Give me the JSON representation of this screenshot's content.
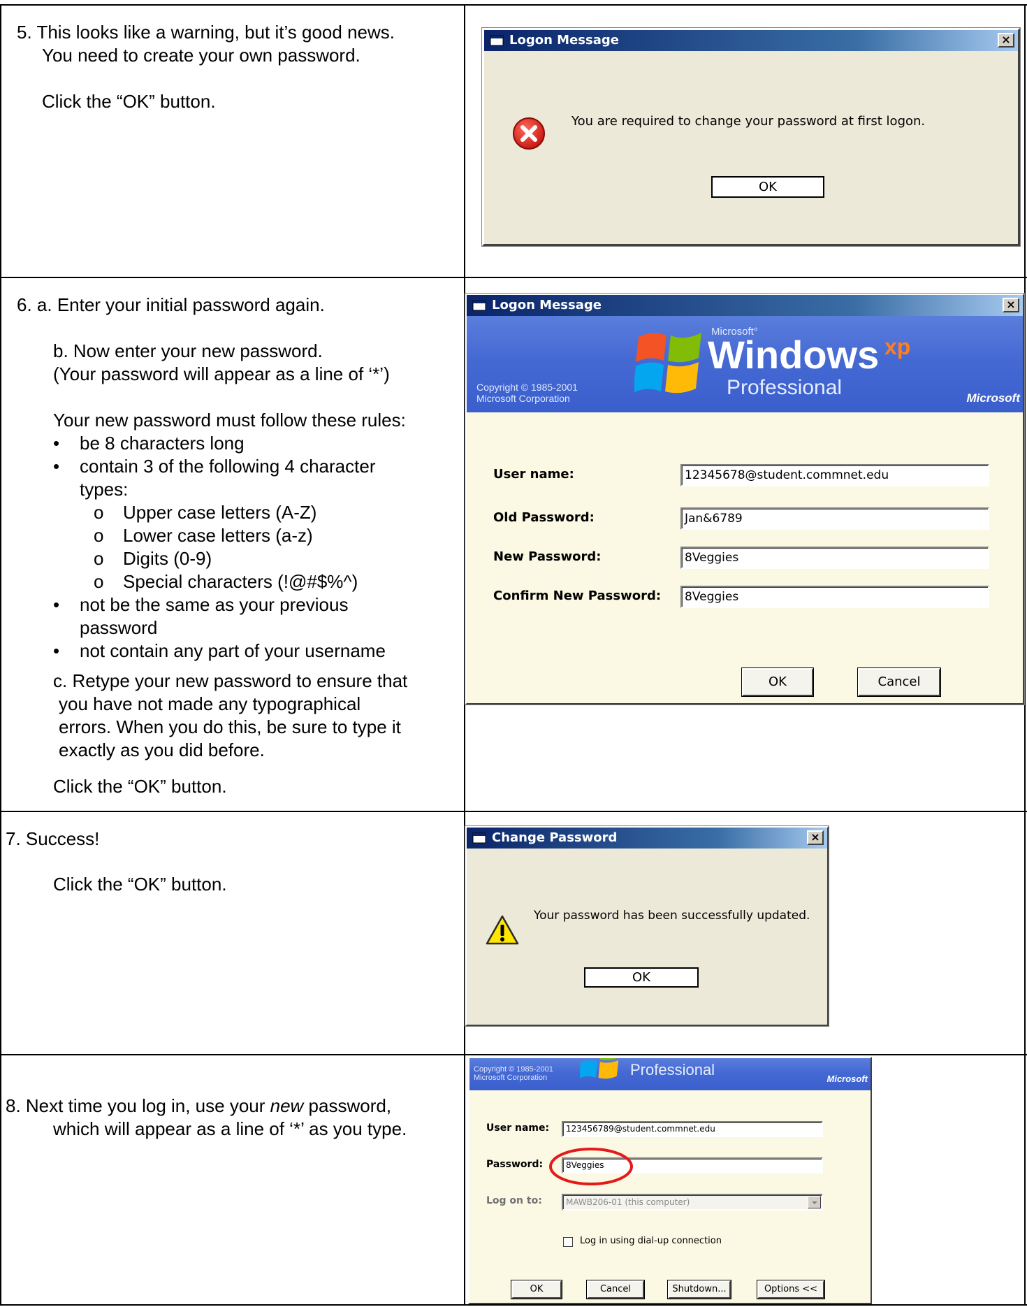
{
  "steps": {
    "step5": {
      "lines": [
        "5. This looks like a warning, but it’s good news.",
        "You need to create your own password.",
        "Click the “OK” button."
      ]
    },
    "step6": {
      "a": "6. a. Enter your initial password again.",
      "b1": "b. Now enter your new password.",
      "b2": "(Your password will appear as a line of ‘*’)",
      "rules_intro": "Your new password must follow these rules:",
      "rule1": "be 8 characters long",
      "rule2a": "contain 3 of the following 4 character",
      "rule2b": "types:",
      "sub1": "Upper case letters (A-Z)",
      "sub2": "Lower case letters (a-z)",
      "sub3": "Digits (0-9)",
      "sub4": "Special characters (!@#$%^)",
      "rule3a": "not be the same as your previous",
      "rule3b": "password",
      "rule4": "not contain any part of your username",
      "c1": "c. Retype your new password to ensure that",
      "c2": "you have not made any typographical",
      "c3": "errors. When you do this, be sure to type it",
      "c4": "exactly as you did before.",
      "click": "Click the “OK” button."
    },
    "step7": {
      "title": "7.  Success!",
      "click": "Click the “OK” button."
    },
    "step8": {
      "pre": "8.  Next time you log in, use your ",
      "em": "new",
      "post": " password,",
      "line2": "which will appear as a line of ‘*’ as you type."
    }
  },
  "dialog1": {
    "title": "Logon Message",
    "close": "×",
    "message": "You are required to change your password at first logon.",
    "ok": "OK"
  },
  "dialog2": {
    "title": "Logon Message",
    "close": "×",
    "ms_small": "Microsoft°",
    "windows": "Windows",
    "xp": "xp",
    "professional": "Professional",
    "copyright1": "Copyright © 1985-2001",
    "copyright2": "Microsoft Corporation",
    "microsoft": "Microsoft",
    "user_label": "User name:",
    "user_value": "12345678@student.commnet.edu",
    "old_label": "Old Password:",
    "old_value": "Jan&6789",
    "new_label": "New Password:",
    "new_value": "8Veggies",
    "confirm_label": "Confirm New Password:",
    "confirm_value": "8Veggies",
    "ok": "OK",
    "cancel": "Cancel"
  },
  "dialog3": {
    "title": "Change Password",
    "close": "×",
    "message": "Your password has been successfully updated.",
    "ok": "OK"
  },
  "dialog4": {
    "professional": "Professional",
    "copyright1": "Copyright © 1985-2001",
    "copyright2": "Microsoft Corporation",
    "microsoft": "Microsoft",
    "user_label": "User name:",
    "user_value": "123456789@student.commnet.edu",
    "password_label": "Password:",
    "password_value": "8Veggies",
    "logon_label": "Log on to:",
    "logon_value": "MAWB206-01 (this computer)",
    "dialup_label": "Log in using dial-up connection",
    "ok": "OK",
    "cancel": "Cancel",
    "shutdown": "Shutdown...",
    "options": "Options <<"
  },
  "colors": {
    "titlebar": "#0a246a",
    "xp_blue": "#4569d3",
    "form_bg": "#fbf9e3",
    "error_red": "#e0231b",
    "warn_yellow": "#ffe600",
    "highlight_circle": "#e21a1a"
  },
  "icons": [
    "error-icon",
    "warning-icon",
    "close-icon",
    "windows-flag-icon",
    "dropdown-arrow-icon",
    "checkbox-icon"
  ]
}
